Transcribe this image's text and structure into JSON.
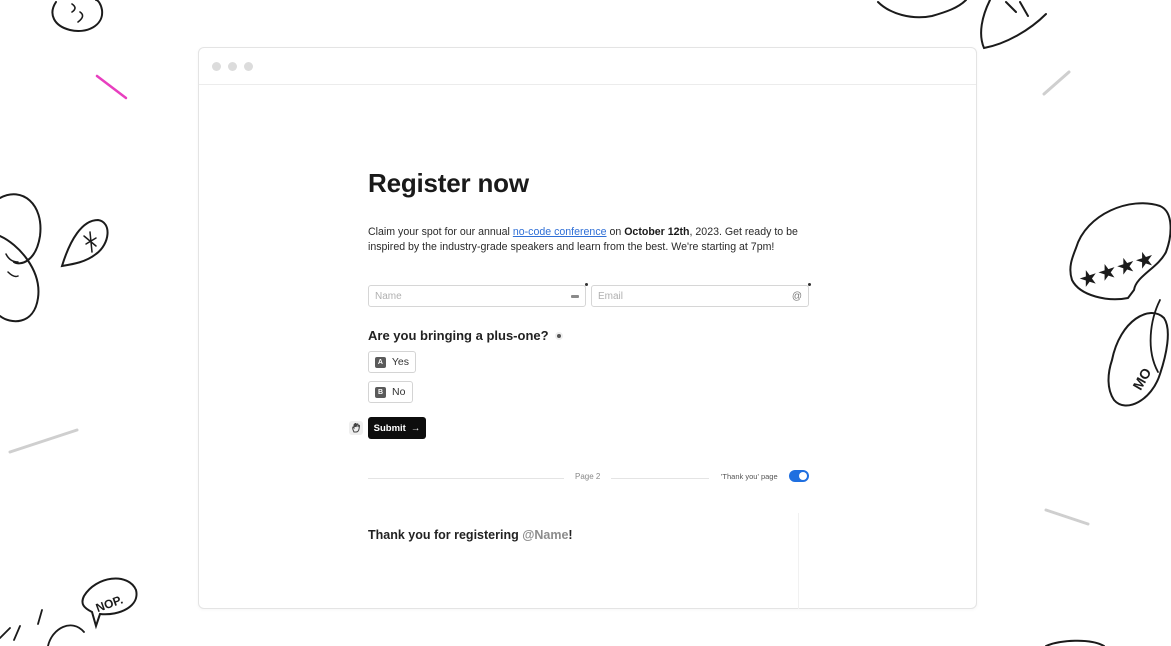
{
  "window": {
    "dots": [
      "close",
      "minimize",
      "maximize"
    ]
  },
  "form": {
    "title": "Register now",
    "description": {
      "part1": "Claim your spot for our annual ",
      "link": "no-code conference",
      "part2": " on ",
      "bold_date": "October 12th",
      "part3": ", 2023. Get ready to be inspired by the industry-grade speakers and learn from the best. We're starting at 7pm!"
    },
    "name_field": {
      "placeholder": "Name",
      "value": ""
    },
    "email_field": {
      "placeholder": "Email",
      "value": "",
      "icon": "@"
    },
    "question": "Are you bringing a plus-one?",
    "options": [
      {
        "key": "A",
        "label": "Yes"
      },
      {
        "key": "B",
        "label": "No"
      }
    ],
    "submit_label": "Submit",
    "submit_arrow": "→"
  },
  "page_divider": {
    "page_label": "Page 2",
    "thank_you_label": "'Thank you' page",
    "thank_you_enabled": true
  },
  "thank_you": {
    "text": "Thank you for registering ",
    "mention": "@Name",
    "suffix": "!"
  },
  "colors": {
    "accent": "#1f6fe0",
    "link": "#2f6fd6",
    "doodle_pink": "#e83fbf",
    "button": "#0d0d0d"
  }
}
